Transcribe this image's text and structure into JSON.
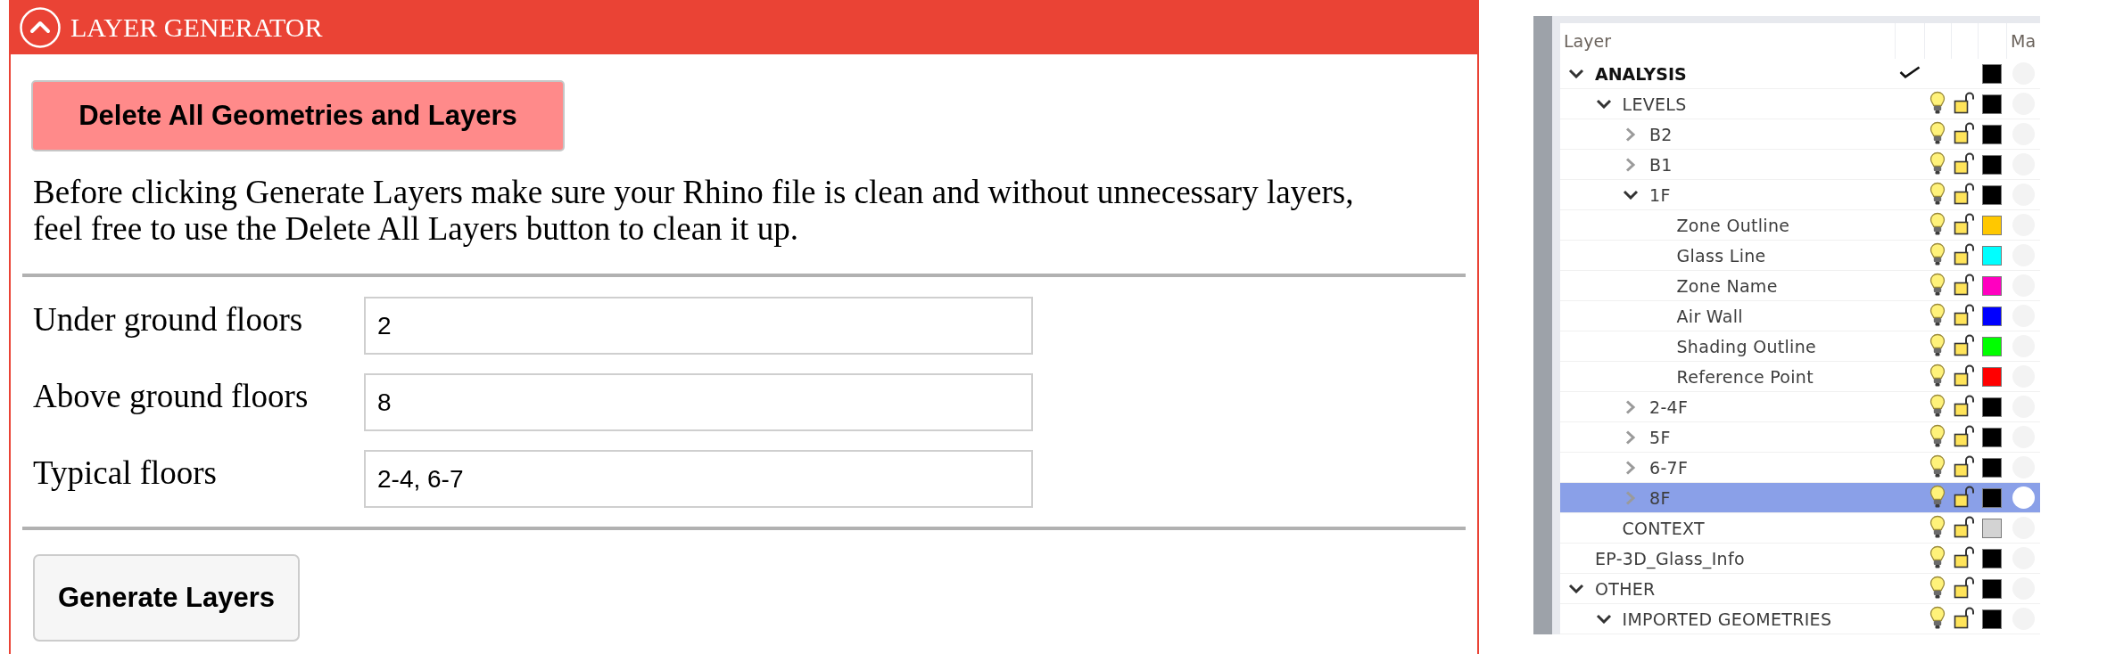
{
  "generator": {
    "title": "LAYER GENERATOR",
    "expanded": true,
    "delete_button": "Delete All Geometries and Layers",
    "note": "Before clicking Generate Layers make sure your Rhino file is clean and without unnecessary layers, feel free to use the Delete All Layers button to clean it up.",
    "fields": [
      {
        "label": "Under ground floors",
        "value": "2"
      },
      {
        "label": "Above ground floors",
        "value": "8"
      },
      {
        "label": "Typical floors",
        "value": "2-4, 6-7"
      }
    ],
    "generate_button": "Generate Layers"
  },
  "layers_panel": {
    "columns": [
      "Layer",
      "Ma"
    ],
    "layers": [
      {
        "name": "ANALYSIS",
        "expanded": true,
        "current": true,
        "selected": false,
        "color": "#000000",
        "children": [
          {
            "name": "LEVELS",
            "expanded": true,
            "current": false,
            "on": true,
            "locked": false,
            "selected": false,
            "color": "#000000",
            "children": [
              {
                "name": "B2",
                "expanded": false,
                "current": false,
                "on": true,
                "locked": false,
                "selected": false,
                "color": "#000000"
              },
              {
                "name": "B1",
                "expanded": false,
                "current": false,
                "on": true,
                "locked": false,
                "selected": false,
                "color": "#000000"
              },
              {
                "name": "1F",
                "expanded": true,
                "current": false,
                "on": true,
                "locked": false,
                "selected": false,
                "color": "#000000",
                "children": [
                  {
                    "name": "Zone Outline",
                    "current": false,
                    "on": true,
                    "locked": false,
                    "selected": false,
                    "color": "#ffc800"
                  },
                  {
                    "name": "Glass Line",
                    "current": false,
                    "on": true,
                    "locked": false,
                    "selected": false,
                    "color": "#00ffff"
                  },
                  {
                    "name": "Zone Name",
                    "current": false,
                    "on": true,
                    "locked": false,
                    "selected": false,
                    "color": "#ff00c0"
                  },
                  {
                    "name": "Air Wall",
                    "current": false,
                    "on": true,
                    "locked": false,
                    "selected": false,
                    "color": "#0000ff"
                  },
                  {
                    "name": "Shading Outline",
                    "current": false,
                    "on": true,
                    "locked": false,
                    "selected": false,
                    "color": "#00ff00"
                  },
                  {
                    "name": "Reference Point",
                    "current": false,
                    "on": true,
                    "locked": false,
                    "selected": false,
                    "color": "#ff0000"
                  }
                ]
              },
              {
                "name": "2-4F",
                "expanded": false,
                "current": false,
                "on": true,
                "locked": false,
                "selected": false,
                "color": "#000000"
              },
              {
                "name": "5F",
                "expanded": false,
                "current": false,
                "on": true,
                "locked": false,
                "selected": false,
                "color": "#000000"
              },
              {
                "name": "6-7F",
                "expanded": false,
                "current": false,
                "on": true,
                "locked": false,
                "selected": false,
                "color": "#000000"
              },
              {
                "name": "8F",
                "expanded": false,
                "current": false,
                "on": true,
                "locked": false,
                "selected": true,
                "color": "#000000"
              }
            ]
          },
          {
            "name": "CONTEXT",
            "current": false,
            "on": true,
            "locked": false,
            "selected": false,
            "color": "#d3d3d3"
          }
        ]
      },
      {
        "name": "EP-3D_Glass_Info",
        "current": false,
        "on": true,
        "locked": false,
        "selected": false,
        "color": "#000000"
      },
      {
        "name": "OTHER",
        "expanded": true,
        "current": false,
        "on": true,
        "locked": false,
        "selected": false,
        "color": "#000000",
        "children": [
          {
            "name": "IMPORTED GEOMETRIES",
            "expanded": true,
            "current": false,
            "on": true,
            "locked": false,
            "selected": false,
            "color": "#000000"
          }
        ]
      }
    ]
  }
}
